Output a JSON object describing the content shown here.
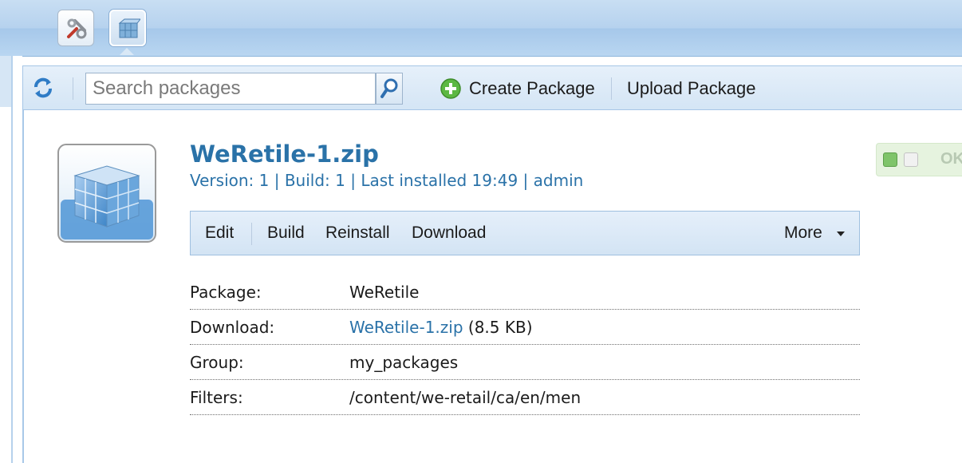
{
  "app": {
    "tools": [
      {
        "icon": "tools-icon"
      },
      {
        "icon": "package-cube-icon"
      }
    ]
  },
  "toolbar": {
    "refresh_icon": "refresh-icon",
    "search_placeholder": "Search packages",
    "search_value": "",
    "search_icon": "magnifier-icon",
    "create_label": "Create Package",
    "upload_label": "Upload Package"
  },
  "package": {
    "title": "WeRetile-1.zip",
    "version_label": "Version: 1",
    "build_label": "Build: 1",
    "installed_label": "Last installed 19:49",
    "user": "admin",
    "status_text": "OK",
    "actions": {
      "edit": "Edit",
      "build": "Build",
      "reinstall": "Reinstall",
      "download": "Download",
      "more": "More"
    },
    "details": {
      "package_label": "Package:",
      "package_value": "WeRetile",
      "download_label": "Download:",
      "download_link": "WeRetile-1.zip",
      "download_size": "(8.5 KB)",
      "group_label": "Group:",
      "group_value": "my_packages",
      "filters_label": "Filters:",
      "filters_value": "/content/we-retail/ca/en/men"
    }
  },
  "colors": {
    "link": "#2a72a8",
    "toolbar_bg": "#dbe9f7",
    "status_green": "#7fc46a"
  }
}
